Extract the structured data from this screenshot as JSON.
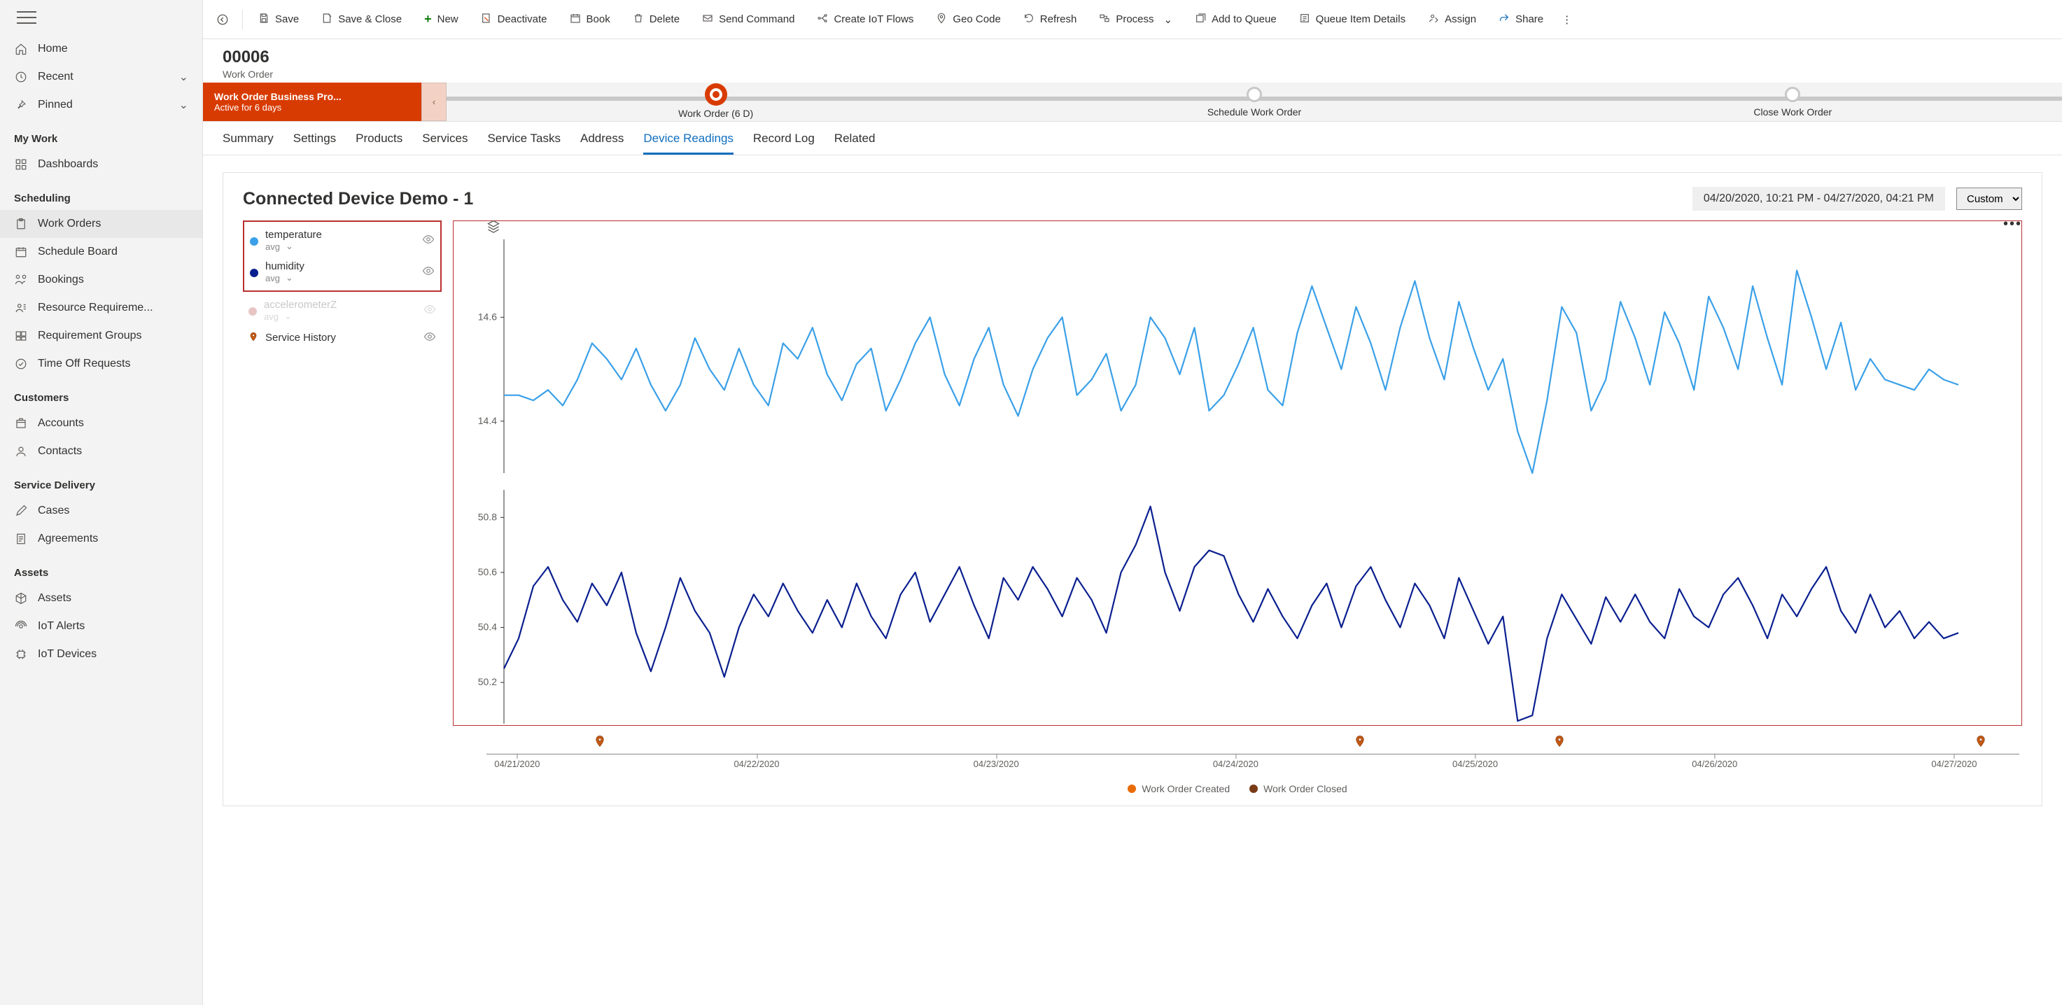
{
  "sidebar": {
    "home": "Home",
    "recent": "Recent",
    "pinned": "Pinned",
    "sections": {
      "mywork": "My Work",
      "scheduling": "Scheduling",
      "customers": "Customers",
      "service_delivery": "Service Delivery",
      "assets": "Assets"
    },
    "items": {
      "dashboards": "Dashboards",
      "work_orders": "Work Orders",
      "schedule_board": "Schedule Board",
      "bookings": "Bookings",
      "resource_req": "Resource Requireme...",
      "req_groups": "Requirement Groups",
      "time_off": "Time Off Requests",
      "accounts": "Accounts",
      "contacts": "Contacts",
      "cases": "Cases",
      "agreements": "Agreements",
      "assets": "Assets",
      "iot_alerts": "IoT Alerts",
      "iot_devices": "IoT Devices"
    }
  },
  "commands": {
    "save": "Save",
    "save_close": "Save & Close",
    "new": "New",
    "deactivate": "Deactivate",
    "book": "Book",
    "delete": "Delete",
    "send_command": "Send Command",
    "create_iot": "Create IoT Flows",
    "geo_code": "Geo Code",
    "refresh": "Refresh",
    "process": "Process",
    "add_queue": "Add to Queue",
    "queue_item": "Queue Item Details",
    "assign": "Assign",
    "share": "Share"
  },
  "header": {
    "record_id": "00006",
    "record_type": "Work Order"
  },
  "bpf": {
    "title": "Work Order Business Pro...",
    "subtitle": "Active for 6 days",
    "stages": [
      {
        "label": "Work Order  (6 D)"
      },
      {
        "label": "Schedule Work Order"
      },
      {
        "label": "Close Work Order"
      }
    ]
  },
  "tabs": [
    "Summary",
    "Settings",
    "Products",
    "Services",
    "Service Tasks",
    "Address",
    "Device Readings",
    "Record Log",
    "Related"
  ],
  "active_tab": "Device Readings",
  "card": {
    "title": "Connected Device Demo - 1",
    "date_range": "04/20/2020, 10:21 PM - 04/27/2020, 04:21 PM",
    "range_mode": "Custom"
  },
  "legend": {
    "agg": "avg",
    "temperature": {
      "name": "temperature",
      "color": "#3aa0e8"
    },
    "humidity": {
      "name": "humidity",
      "color": "#0a1f8f"
    },
    "accelerometer": {
      "name": "accelerometerZ",
      "color": "#e8c5c5"
    },
    "service_history": "Service History"
  },
  "bottom_legend": {
    "created": {
      "label": "Work Order Created",
      "color": "#e86c0a"
    },
    "closed": {
      "label": "Work Order Closed",
      "color": "#7a3b17"
    }
  },
  "chart_data": {
    "type": "line",
    "x_labels": [
      "04/21/2020",
      "04/22/2020",
      "04/23/2020",
      "04/24/2020",
      "04/25/2020",
      "04/26/2020",
      "04/27/2020"
    ],
    "series": [
      {
        "name": "temperature",
        "color": "#3aa0e8",
        "yrange": [
          14.3,
          14.75
        ],
        "yticks": [
          14.4,
          14.6
        ],
        "values": [
          14.45,
          14.45,
          14.44,
          14.46,
          14.43,
          14.48,
          14.55,
          14.52,
          14.48,
          14.54,
          14.47,
          14.42,
          14.47,
          14.56,
          14.5,
          14.46,
          14.54,
          14.47,
          14.43,
          14.55,
          14.52,
          14.58,
          14.49,
          14.44,
          14.51,
          14.54,
          14.42,
          14.48,
          14.55,
          14.6,
          14.49,
          14.43,
          14.52,
          14.58,
          14.47,
          14.41,
          14.5,
          14.56,
          14.6,
          14.45,
          14.48,
          14.53,
          14.42,
          14.47,
          14.6,
          14.56,
          14.49,
          14.58,
          14.42,
          14.45,
          14.51,
          14.58,
          14.46,
          14.43,
          14.57,
          14.66,
          14.58,
          14.5,
          14.62,
          14.55,
          14.46,
          14.58,
          14.67,
          14.56,
          14.48,
          14.63,
          14.54,
          14.46,
          14.52,
          14.38,
          14.3,
          14.44,
          14.62,
          14.57,
          14.42,
          14.48,
          14.63,
          14.56,
          14.47,
          14.61,
          14.55,
          14.46,
          14.64,
          14.58,
          14.5,
          14.66,
          14.56,
          14.47,
          14.69,
          14.6,
          14.5,
          14.59,
          14.46,
          14.52,
          14.48,
          14.47,
          14.46,
          14.5,
          14.48,
          14.47
        ]
      },
      {
        "name": "humidity",
        "color": "#0a1f8f",
        "yrange": [
          50.05,
          50.9
        ],
        "yticks": [
          50.2,
          50.4,
          50.6,
          50.8
        ],
        "values": [
          50.25,
          50.36,
          50.55,
          50.62,
          50.5,
          50.42,
          50.56,
          50.48,
          50.6,
          50.38,
          50.24,
          50.4,
          50.58,
          50.46,
          50.38,
          50.22,
          50.4,
          50.52,
          50.44,
          50.56,
          50.46,
          50.38,
          50.5,
          50.4,
          50.56,
          50.44,
          50.36,
          50.52,
          50.6,
          50.42,
          50.52,
          50.62,
          50.48,
          50.36,
          50.58,
          50.5,
          50.62,
          50.54,
          50.44,
          50.58,
          50.5,
          50.38,
          50.6,
          50.7,
          50.84,
          50.6,
          50.46,
          50.62,
          50.68,
          50.66,
          50.52,
          50.42,
          50.54,
          50.44,
          50.36,
          50.48,
          50.56,
          50.4,
          50.55,
          50.62,
          50.5,
          50.4,
          50.56,
          50.48,
          50.36,
          50.58,
          50.46,
          50.34,
          50.44,
          50.06,
          50.08,
          50.36,
          50.52,
          50.43,
          50.34,
          50.51,
          50.42,
          50.52,
          50.42,
          50.36,
          50.54,
          50.44,
          50.4,
          50.52,
          50.58,
          50.48,
          50.36,
          50.52,
          50.44,
          50.54,
          50.62,
          50.46,
          50.38,
          50.52,
          50.4,
          50.46,
          50.36,
          50.42,
          50.36,
          50.38
        ]
      }
    ],
    "pins_pct": [
      7.4,
      57.0,
      70.0,
      97.5
    ]
  }
}
